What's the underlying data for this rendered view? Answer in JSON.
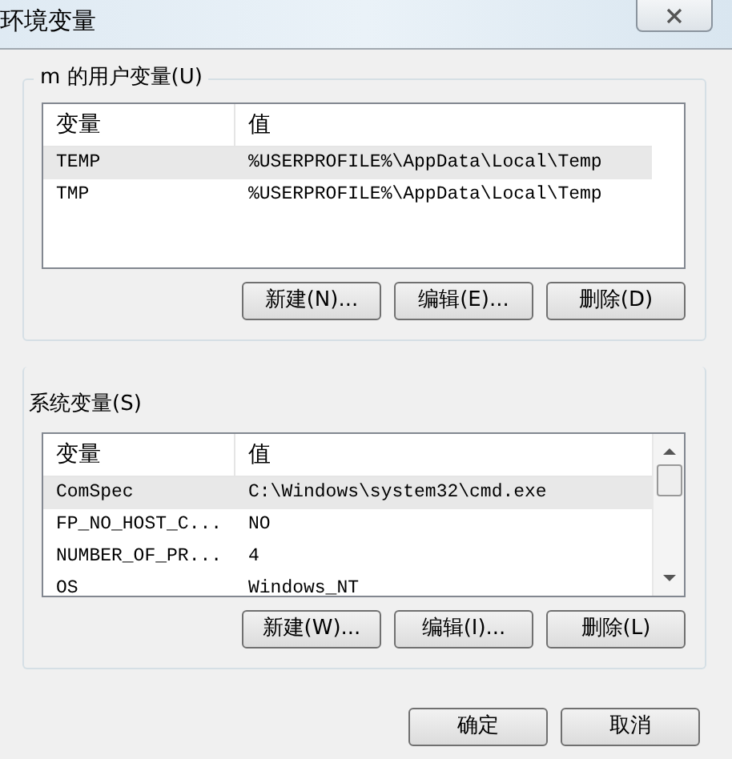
{
  "window": {
    "title": "环境变量"
  },
  "user_variables": {
    "title": "m 的用户变量(U)",
    "columns": [
      "变量",
      "值"
    ],
    "rows": [
      {
        "name": "TEMP",
        "value": "%USERPROFILE%\\AppData\\Local\\Temp",
        "selected": true
      },
      {
        "name": "TMP",
        "value": "%USERPROFILE%\\AppData\\Local\\Temp",
        "selected": false
      }
    ],
    "buttons": [
      "新建(N)...",
      "编辑(E)...",
      "删除(D)"
    ]
  },
  "system_variables": {
    "title": "系统变量(S)",
    "columns": [
      "变量",
      "值"
    ],
    "rows": [
      {
        "name": "ComSpec",
        "value": "C:\\Windows\\system32\\cmd.exe",
        "selected": true
      },
      {
        "name": "FP_NO_HOST_C...",
        "value": "NO",
        "selected": false
      },
      {
        "name": "NUMBER_OF_PR...",
        "value": "4",
        "selected": false
      },
      {
        "name": "OS",
        "value": "Windows_NT",
        "selected": false
      }
    ],
    "buttons": [
      "新建(W)...",
      "编辑(I)...",
      "删除(L)"
    ]
  },
  "footer_buttons": [
    "确定",
    "取消"
  ]
}
